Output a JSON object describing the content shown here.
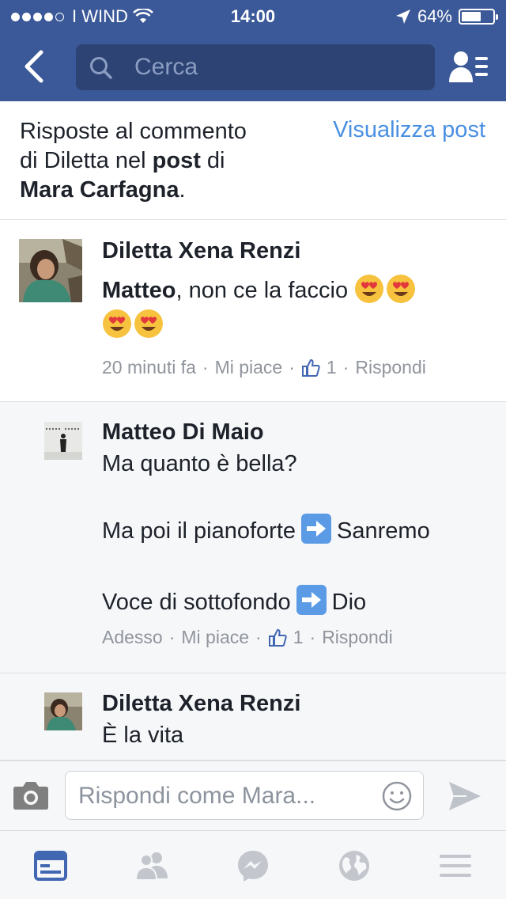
{
  "status": {
    "carrier": "I WIND",
    "time": "14:00",
    "battery": "64%",
    "battery_level": 0.64
  },
  "search": {
    "placeholder": "Cerca"
  },
  "header": {
    "line1": "Risposte al commento",
    "line2a": "di Diletta nel ",
    "line2b": "post",
    "line2c": " di",
    "line3a": "Mara Carfagna",
    "line3b": ".",
    "view_post": "Visualizza post"
  },
  "comments": [
    {
      "author": "Diletta Xena Renzi",
      "mention": "Matteo",
      "text": ", non ce la faccio",
      "time": "20 minuti fa",
      "like": "Mi piace",
      "likes": "1",
      "reply": "Rispondi"
    },
    {
      "author": "Matteo Di Maio",
      "line1": "Ma quanto è bella?",
      "line2a": "Ma poi il pianoforte",
      "line2b": "Sanremo",
      "line3a": "Voce di sottofondo",
      "line3b": "Dio",
      "time": "Adesso",
      "like": "Mi piace",
      "likes": "1",
      "reply": "Rispondi"
    },
    {
      "author": "Diletta Xena Renzi",
      "text": "È la vita"
    }
  ],
  "composer": {
    "placeholder": "Rispondi come Mara..."
  },
  "colors": {
    "brand": "#3b5998",
    "link": "#4a90e2",
    "active_tab": "#4267b2"
  }
}
